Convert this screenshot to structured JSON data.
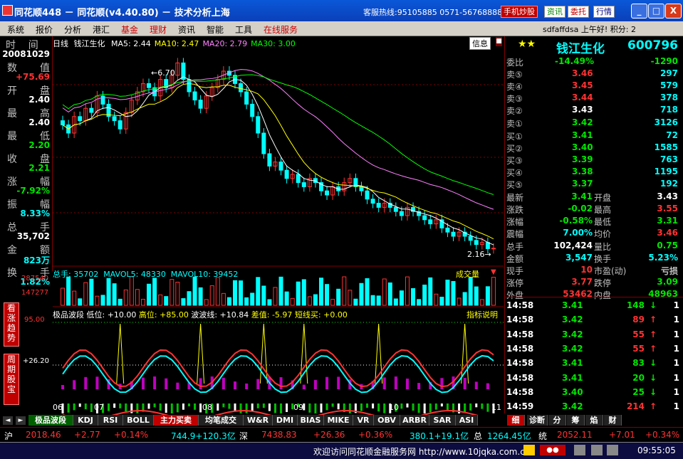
{
  "window": {
    "title": "同花顺448 － 同花顺(v4.40.80) － 技术分析上海",
    "hotline": "客服热线:95105885 0571-56768888",
    "buttons": [
      "手机炒股",
      "资讯",
      "委托",
      "行情"
    ],
    "controls": [
      "_",
      "□",
      "X"
    ]
  },
  "menu": {
    "items": [
      "系统",
      "报价",
      "分析",
      "港汇",
      "基金",
      "理财",
      "资讯",
      "智能",
      "工具",
      "在线服务"
    ],
    "red_items": [
      4,
      5,
      9
    ],
    "greeting": "sdfaffdsa 上午好! 积分: 2"
  },
  "left_info": {
    "header_label": "时    间",
    "date": "20081029",
    "items": [
      {
        "label": "数",
        "label2": "值",
        "value": "+75.69",
        "color": "red"
      },
      {
        "label": "开",
        "label2": "盘",
        "value": "2.40",
        "color": "white"
      },
      {
        "label": "最",
        "label2": "高",
        "value": "2.40",
        "color": "white"
      },
      {
        "label": "最",
        "label2": "低",
        "value": "2.20",
        "color": "green"
      },
      {
        "label": "收",
        "label2": "盘",
        "value": "2.21",
        "color": "green"
      },
      {
        "label": "涨",
        "label2": "幅",
        "value": "-7.92%",
        "color": "green"
      },
      {
        "label": "振",
        "label2": "幅",
        "value": "8.33%",
        "color": "cyan"
      },
      {
        "label": "总",
        "label2": "手",
        "value": "35,702",
        "color": "white"
      },
      {
        "label": "金",
        "label2": "额",
        "value": "823万",
        "color": "cyan"
      },
      {
        "label": "换",
        "label2": "手",
        "value": "1.82%",
        "color": "cyan"
      }
    ]
  },
  "main_chart": {
    "period_label": "日线",
    "stock_name": "钱江生化",
    "ma": [
      {
        "label": "MA5: 2.44",
        "color": "#ffffff"
      },
      {
        "label": "MA10: 2.47",
        "color": "#ffff00"
      },
      {
        "label": "MA20: 2.79",
        "color": "#ff80ff"
      },
      {
        "label": "MA30: 3.00",
        "color": "#00ff00"
      }
    ],
    "info_button": "信息",
    "high_marker": "6.70",
    "low_marker": "2.16",
    "volume_header": "总手: 35702  MAVOL5: 48330  MAVOL10: 39452",
    "volume_label": "成交量",
    "volume_axis": [
      "287540",
      "147277"
    ],
    "indicator_header": {
      "name": "极品波段",
      "low": "低位: +10.00",
      "high": "高位: +85.00",
      "wave": "波波线: +10.84",
      "diff": "差值: -5.97",
      "short": "短线买: +0.00",
      "help": "指标说明"
    },
    "indicator_axis": [
      "95.00",
      "+26.20"
    ],
    "x_labels": [
      "06",
      "07",
      "08",
      "09",
      "10",
      "11"
    ],
    "left_tabs": [
      "看涨趋势",
      "周期股宝"
    ]
  },
  "quote": {
    "stars": "★★",
    "name": "钱江生化",
    "code": "600796",
    "weibi": {
      "label": "委比",
      "value": "-14.49%",
      "diff": "-1290"
    },
    "sell": [
      {
        "label": "卖⑤",
        "price": "3.46",
        "vol": "297",
        "pcolor": "red"
      },
      {
        "label": "卖④",
        "price": "3.45",
        "vol": "579",
        "pcolor": "red"
      },
      {
        "label": "卖③",
        "price": "3.44",
        "vol": "378",
        "pcolor": "red"
      },
      {
        "label": "卖②",
        "price": "3.43",
        "vol": "718",
        "pcolor": "white"
      },
      {
        "label": "卖①",
        "price": "3.42",
        "vol": "3126",
        "pcolor": "green"
      }
    ],
    "buy": [
      {
        "label": "买①",
        "price": "3.41",
        "vol": "72",
        "pcolor": "green"
      },
      {
        "label": "买②",
        "price": "3.40",
        "vol": "1585",
        "pcolor": "green"
      },
      {
        "label": "买③",
        "price": "3.39",
        "vol": "763",
        "pcolor": "green"
      },
      {
        "label": "买④",
        "price": "3.38",
        "vol": "1195",
        "pcolor": "green"
      },
      {
        "label": "买⑤",
        "price": "3.37",
        "vol": "192",
        "pcolor": "green"
      }
    ],
    "stats": [
      {
        "l1": "最新",
        "v1": "3.41",
        "c1": "green",
        "l2": "开盘",
        "v2": "3.43",
        "c2": "white"
      },
      {
        "l1": "涨跌",
        "v1": "-0.02",
        "c1": "green",
        "l2": "最高",
        "v2": "3.55",
        "c2": "red"
      },
      {
        "l1": "涨幅",
        "v1": "-0.58%",
        "c1": "green",
        "l2": "最低",
        "v2": "3.31",
        "c2": "green"
      },
      {
        "l1": "震幅",
        "v1": "7.00%",
        "c1": "cyan",
        "l2": "均价",
        "v2": "3.46",
        "c2": "red"
      },
      {
        "l1": "总手",
        "v1": "102,424",
        "c1": "white",
        "l2": "量比",
        "v2": "0.75",
        "c2": "green"
      },
      {
        "l1": "金额",
        "v1": "3,547",
        "c1": "cyan",
        "l2": "换手",
        "v2": "5.23%",
        "c2": "cyan"
      },
      {
        "l1": "现手",
        "v1": "10",
        "c1": "red",
        "l2": "市盈(动)",
        "v2": "亏损",
        "c2": "grey"
      },
      {
        "l1": "涨停",
        "v1": "3.77",
        "c1": "red",
        "l2": "跌停",
        "v2": "3.09",
        "c2": "green"
      },
      {
        "l1": "外盘",
        "v1": "53462",
        "c1": "red",
        "l2": "内盘",
        "v2": "48963",
        "c2": "green"
      }
    ],
    "ticks": [
      {
        "time": "14:58",
        "price": "3.41",
        "vol": "148",
        "dir": "down",
        "n": "1"
      },
      {
        "time": "14:58",
        "price": "3.42",
        "vol": "89",
        "dir": "up",
        "n": "1"
      },
      {
        "time": "14:58",
        "price": "3.42",
        "vol": "55",
        "dir": "up",
        "n": "1"
      },
      {
        "time": "14:58",
        "price": "3.42",
        "vol": "55",
        "dir": "up",
        "n": "1"
      },
      {
        "time": "14:58",
        "price": "3.41",
        "vol": "83",
        "dir": "down",
        "n": "1"
      },
      {
        "time": "14:58",
        "price": "3.41",
        "vol": "20",
        "dir": "down",
        "n": "1"
      },
      {
        "time": "14:58",
        "price": "3.40",
        "vol": "25",
        "dir": "down",
        "n": "1"
      },
      {
        "time": "14:59",
        "price": "3.42",
        "vol": "214",
        "dir": "up",
        "n": "1"
      }
    ]
  },
  "bottom_tabs": [
    "极品波段",
    "KDJ",
    "RSI",
    "BOLL",
    "主力买卖",
    "均笔成交",
    "W&R",
    "DMI",
    "BIAS",
    "MIKE",
    "VR",
    "OBV",
    "ARBR",
    "SAR",
    "ASI"
  ],
  "right_tabs": [
    "细",
    "诊断",
    "分",
    "筹",
    "焰",
    "财"
  ],
  "index_bar": {
    "sh_label": "沪",
    "sh_value": "2018.46",
    "sh_change": "+2.77",
    "sh_pct": "+0.14%",
    "sh_amount": "744.9+120.3亿",
    "sz_label": "深",
    "sz_value": "7438.83",
    "sz_change": "+26.36",
    "sz_pct": "+0.36%",
    "sz_amount": "380.1+19.1亿",
    "zong_label": "总",
    "zong_value": "1264.45亿",
    "tong_label": "统",
    "tong_value": "2052.11",
    "tong_change": "+7.01",
    "tong_pct": "+0.34%"
  },
  "status": {
    "welcome": "欢迎访问同花顺金融服务网 http://www.10jqka.com.cn",
    "clock": "09:55:05"
  },
  "chart_data": {
    "type": "candlestick",
    "stock": "钱江生化",
    "x_labels": [
      "06",
      "07",
      "08",
      "09",
      "10",
      "11"
    ],
    "price_high_marker": 6.7,
    "price_low_marker": 2.16,
    "ma_values": {
      "MA5": 2.44,
      "MA10": 2.47,
      "MA20": 2.79,
      "MA30": 3.0
    },
    "closes": [
      5.2,
      5.0,
      5.4,
      5.3,
      5.6,
      5.5,
      5.9,
      5.7,
      5.4,
      5.3,
      5.1,
      5.5,
      5.8,
      6.0,
      6.2,
      6.1,
      5.9,
      6.3,
      6.1,
      6.4,
      6.7,
      6.3,
      6.0,
      5.8,
      5.6,
      5.9,
      6.1,
      6.3,
      6.5,
      6.4,
      6.2,
      6.0,
      5.7,
      5.4,
      5.0,
      4.5,
      4.2,
      4.3,
      4.1,
      3.9,
      4.0,
      3.8,
      3.7,
      3.9,
      3.8,
      3.6,
      3.5,
      3.7,
      3.6,
      3.8,
      3.9,
      3.7,
      3.6,
      3.4,
      3.3,
      3.2,
      3.3,
      3.2,
      3.1,
      3.0,
      3.2,
      3.1,
      3.0,
      2.9,
      2.8,
      2.9,
      2.7,
      2.6,
      2.5,
      2.6,
      2.5,
      2.4,
      2.3,
      2.35,
      2.2,
      2.21
    ],
    "volume_axis": [
      287540,
      147277
    ],
    "indicator_axis": [
      95.0,
      26.2
    ]
  }
}
